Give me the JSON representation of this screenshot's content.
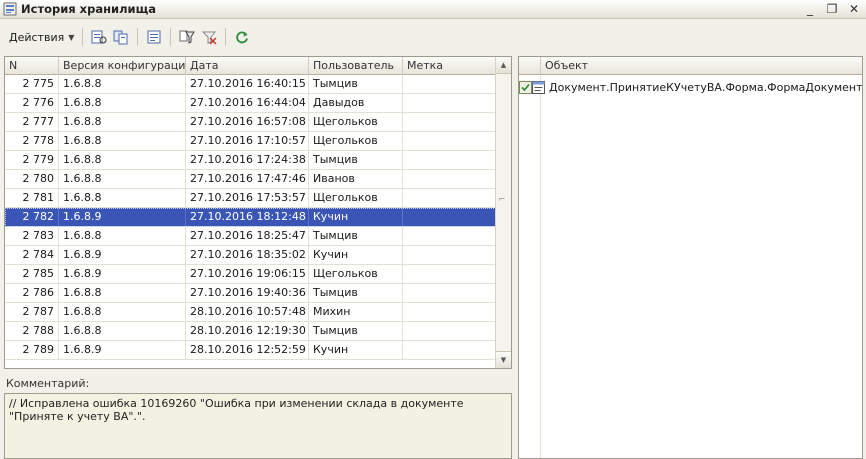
{
  "window": {
    "title": "История хранилища",
    "icon": "storage-history-icon",
    "buttons": [
      "minimize",
      "restore",
      "close"
    ]
  },
  "toolbar": {
    "actions_label": "Действия",
    "icons": [
      "view-version-icon",
      "compare-icon",
      "report-icon",
      "filter-icon",
      "clear-filter-icon",
      "refresh-icon"
    ]
  },
  "history": {
    "columns": [
      "N",
      "Версия конфигурации",
      "Дата",
      "Пользователь",
      "Метка"
    ],
    "rows": [
      {
        "n": "2 775",
        "ver": "1.6.8.8",
        "date": "27.10.2016 16:40:15",
        "user": "Тымцив",
        "tag": ""
      },
      {
        "n": "2 776",
        "ver": "1.6.8.8",
        "date": "27.10.2016 16:44:04",
        "user": "Давыдов",
        "tag": ""
      },
      {
        "n": "2 777",
        "ver": "1.6.8.8",
        "date": "27.10.2016 16:57:08",
        "user": "Щегольков",
        "tag": ""
      },
      {
        "n": "2 778",
        "ver": "1.6.8.8",
        "date": "27.10.2016 17:10:57",
        "user": "Щегольков",
        "tag": ""
      },
      {
        "n": "2 779",
        "ver": "1.6.8.8",
        "date": "27.10.2016 17:24:38",
        "user": "Тымцив",
        "tag": ""
      },
      {
        "n": "2 780",
        "ver": "1.6.8.8",
        "date": "27.10.2016 17:47:46",
        "user": "Иванов",
        "tag": ""
      },
      {
        "n": "2 781",
        "ver": "1.6.8.8",
        "date": "27.10.2016 17:53:57",
        "user": "Щегольков",
        "tag": ""
      },
      {
        "n": "2 782",
        "ver": "1.6.8.9",
        "date": "27.10.2016 18:12:48",
        "user": "Кучин",
        "tag": "",
        "selected": true
      },
      {
        "n": "2 783",
        "ver": "1.6.8.8",
        "date": "27.10.2016 18:25:47",
        "user": "Тымцив",
        "tag": ""
      },
      {
        "n": "2 784",
        "ver": "1.6.8.9",
        "date": "27.10.2016 18:35:02",
        "user": "Кучин",
        "tag": ""
      },
      {
        "n": "2 785",
        "ver": "1.6.8.9",
        "date": "27.10.2016 19:06:15",
        "user": "Щегольков",
        "tag": ""
      },
      {
        "n": "2 786",
        "ver": "1.6.8.8",
        "date": "27.10.2016 19:40:36",
        "user": "Тымцив",
        "tag": ""
      },
      {
        "n": "2 787",
        "ver": "1.6.8.8",
        "date": "28.10.2016 10:57:48",
        "user": "Михин",
        "tag": ""
      },
      {
        "n": "2 788",
        "ver": "1.6.8.8",
        "date": "28.10.2016 12:19:30",
        "user": "Тымцив",
        "tag": ""
      },
      {
        "n": "2 789",
        "ver": "1.6.8.9",
        "date": "28.10.2016 12:52:59",
        "user": "Кучин",
        "tag": ""
      }
    ]
  },
  "comment": {
    "label": "Комментарий:",
    "text": "// Исправлена ошибка 10169260 \"Ошибка при изменении склада в документе \"Приняте к учету ВА\".\"."
  },
  "objects": {
    "header": "Объект",
    "items": [
      {
        "name": "Документ.ПринятиеКУчетуВА.Форма.ФормаДокумента",
        "icon": "form-icon",
        "status_icon": "changed-marker-icon"
      }
    ]
  },
  "colors": {
    "selection": "#3b55b6",
    "background": "#f2f1e9",
    "comment_bg": "#f3f2e2"
  }
}
